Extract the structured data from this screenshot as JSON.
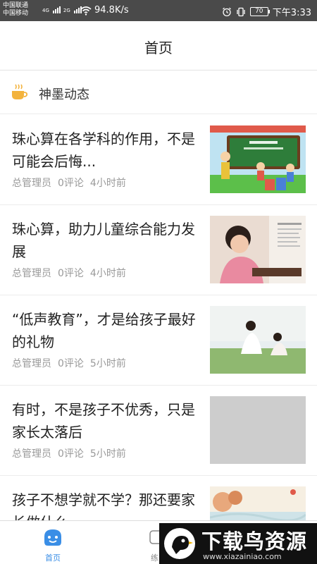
{
  "status_bar": {
    "carrier_1": "中国联通",
    "carrier_2": "中国移动",
    "net_1": "4G",
    "net_2": "2G",
    "speed": "94.8K/s",
    "battery": "70",
    "time": "下午3:33"
  },
  "nav": {
    "title": "首页"
  },
  "section": {
    "title": "神墨动态",
    "icon": "coffee-cup-icon",
    "icon_color": "#f3b33d"
  },
  "news": [
    {
      "title": "珠心算在各学科的作用，不是可能会后悔...",
      "author": "总管理员",
      "comments": "0评论",
      "time": "4小时前",
      "image": "classroom-cartoon-image"
    },
    {
      "title": "珠心算，助力儿童综合能力发展",
      "author": "总管理员",
      "comments": "0评论",
      "time": "4小时前",
      "image": "girl-abacus-photo"
    },
    {
      "title": "“低声教育”，才是给孩子最好的礼物",
      "author": "总管理员",
      "comments": "0评论",
      "time": "5小时前",
      "image": "mother-child-photo"
    },
    {
      "title": "有时，不是孩子不优秀，只是家长太落后",
      "author": "总管理员",
      "comments": "0评论",
      "time": "5小时前",
      "image": "placeholder-image"
    },
    {
      "title": "孩子不想学就不学？那还要家长做什么",
      "author": "",
      "comments": "",
      "time": "",
      "image": "autumn-illustration-image"
    }
  ],
  "tabs": [
    {
      "label": "首页",
      "icon": "home-icon",
      "active": true
    },
    {
      "label": "练",
      "icon": "practice-icon",
      "active": false
    }
  ],
  "watermark": {
    "title": "下载鸟资源",
    "url": "www.xiazainiao.com"
  },
  "colors": {
    "status_bar": "#4a4a4a",
    "accent": "#3a8ee6",
    "meta_text": "#999999"
  }
}
